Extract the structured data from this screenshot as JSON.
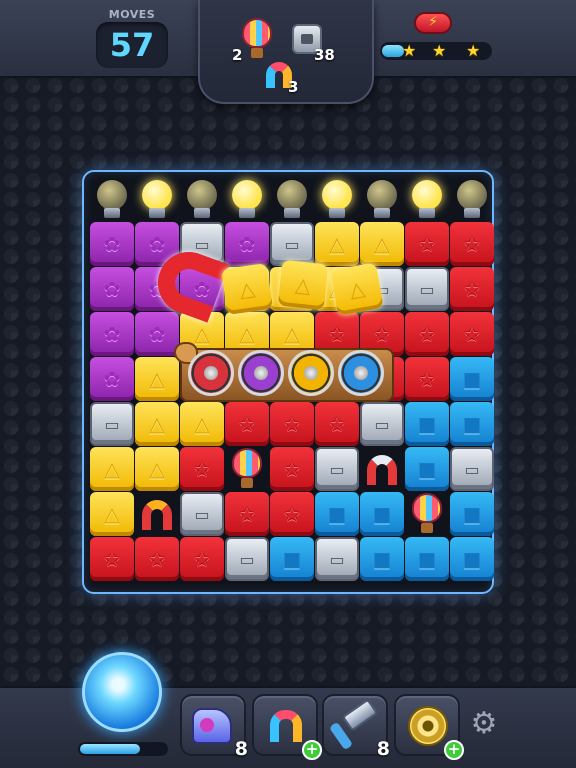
{
  "moves": {
    "label": "MOVES",
    "value": "57"
  },
  "goals": [
    {
      "name": "balloon",
      "count": "2"
    },
    {
      "name": "metal-box",
      "count": "38"
    },
    {
      "name": "rainbow-magnet",
      "count": "3"
    }
  ],
  "stars": {
    "count": 3,
    "progress": 0.2
  },
  "board": {
    "bulbs": [
      "off",
      "on",
      "off",
      "on",
      "off",
      "on",
      "off",
      "on",
      "off"
    ],
    "rows": [
      [
        "purple",
        "purple",
        "metal",
        "purple",
        "metal",
        "yellow",
        "yellow",
        "red",
        "red"
      ],
      [
        "purple",
        "purple",
        "purple",
        "yellow",
        "yellow",
        "yellow",
        "metal",
        "metal",
        "red"
      ],
      [
        "purple",
        "purple",
        "yellow",
        "yellow",
        "yellow",
        "red",
        "red",
        "red",
        "red"
      ],
      [
        "purple",
        "yellow",
        "red",
        "red",
        "red",
        "red",
        "red",
        "red",
        "blue"
      ],
      [
        "metal",
        "yellow",
        "yellow",
        "red",
        "red",
        "red",
        "metal",
        "blue",
        "blue"
      ],
      [
        "yellow",
        "yellow",
        "red",
        "balloon",
        "red",
        "metal",
        "magnet",
        "blue",
        "metal"
      ],
      [
        "yellow",
        "magnet",
        "metal",
        "red",
        "red",
        "blue",
        "blue",
        "balloon",
        "blue"
      ],
      [
        "red",
        "red",
        "red",
        "metal",
        "blue",
        "metal",
        "blue",
        "blue",
        "blue"
      ]
    ]
  },
  "overlay": {
    "shield_colors": [
      "#d8323c",
      "#9a3fd0",
      "#f2b400",
      "#2c8fe2"
    ]
  },
  "power_meter": {
    "progress": 0.7
  },
  "boosters": [
    {
      "name": "ray-gun",
      "count": "8"
    },
    {
      "name": "rainbow-magnet",
      "count": ""
    },
    {
      "name": "hammer",
      "count": "8"
    },
    {
      "name": "wheel",
      "count": ""
    }
  ],
  "icons": {
    "lightning": "⚡",
    "star": "★",
    "gear": "⚙",
    "plus": "+",
    "triangle": "△",
    "star_glyph": "✩",
    "box": "▭"
  }
}
